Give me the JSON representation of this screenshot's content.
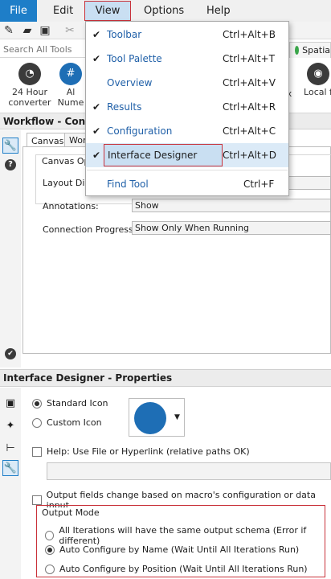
{
  "menubar": {
    "file": "File",
    "edit": "Edit",
    "view": "View",
    "options": "Options",
    "help": "Help"
  },
  "search": {
    "placeholder": "Search All Tools"
  },
  "palette_tab": {
    "label": "Spatia"
  },
  "palette_tools": [
    {
      "line1": "24 Hour",
      "line2": "converter"
    },
    {
      "line1": "Al",
      "line2": "Nume"
    },
    {
      "line1": "x",
      "line2": ""
    },
    {
      "line1": "Local f",
      "line2": ""
    }
  ],
  "view_menu": {
    "items": [
      {
        "label": "Toolbar",
        "checked": true,
        "shortcut": "Ctrl+Alt+B"
      },
      {
        "label": "Tool Palette",
        "checked": true,
        "shortcut": "Ctrl+Alt+T"
      },
      {
        "label": "Overview",
        "checked": false,
        "shortcut": "Ctrl+Alt+V"
      },
      {
        "label": "Results",
        "checked": true,
        "shortcut": "Ctrl+Alt+R"
      },
      {
        "label": "Configuration",
        "checked": true,
        "shortcut": "Ctrl+Alt+C"
      },
      {
        "label": "Interface Designer",
        "checked": true,
        "shortcut": "Ctrl+Alt+D",
        "highlighted": true
      },
      {
        "label": "Find Tool",
        "checked": false,
        "shortcut": "Ctrl+F"
      }
    ],
    "check_glyph": "✔"
  },
  "workflow": {
    "title": "Workflow - Conf",
    "tabs": [
      "Canvas",
      "Wor"
    ],
    "group_label": "Canvas Op",
    "layout_label": "Layout Dir",
    "annotations_label": "Annotations:",
    "annotations_value": "Show",
    "connection_label": "Connection Progress:",
    "connection_value": "Show Only When Running"
  },
  "interface_designer": {
    "title": "Interface Designer - Properties",
    "standard_icon": "Standard Icon",
    "custom_icon": "Custom Icon",
    "help_label": "Help: Use File or Hyperlink (relative paths OK)",
    "output_fields_label": "Output fields change based on macro's configuration or data input",
    "output_mode_label": "Output Mode",
    "output_modes": [
      {
        "label": "All Iterations will have the same output schema (Error if different)",
        "selected": false
      },
      {
        "label": "Auto Configure by Name (Wait Until All Iterations Run)",
        "selected": true
      },
      {
        "label": "Auto Configure by Position (Wait Until All Iterations Run)",
        "selected": false
      }
    ],
    "icon_color": "#1e6eb5"
  },
  "colors": {
    "accent": "#1e7ec8",
    "highlight_border": "#c9323a",
    "menu_text": "#2060a8"
  }
}
